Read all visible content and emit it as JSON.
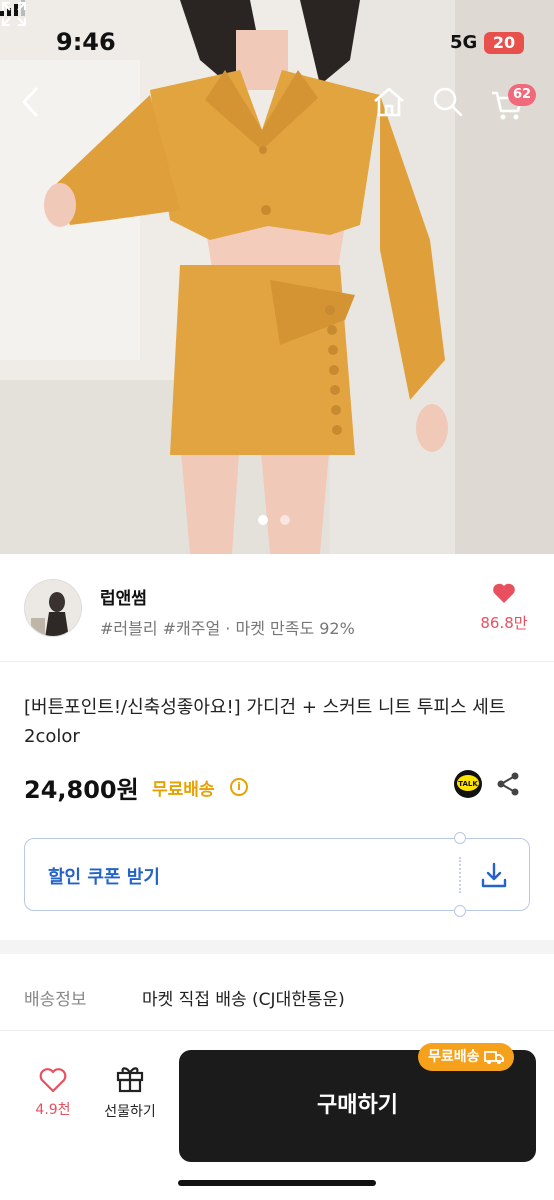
{
  "status": {
    "time": "9:46",
    "network": "5G",
    "battery": "20"
  },
  "nav": {
    "cart_count": "62"
  },
  "carousel": {
    "pages": 2,
    "active": 1
  },
  "shop": {
    "name": "럽앤썸",
    "tags": "#러블리 #캐주얼 · 마켓 만족도 92%",
    "likes": "86.8만"
  },
  "product": {
    "title": "[버튼포인트!/신축성좋아요!] 가디건 + 스커트 니트 투피스 세트 2color",
    "price": "24,800원",
    "free_shipping": "무료배송"
  },
  "coupon": {
    "label": "할인 쿠폰 받기"
  },
  "shipping": {
    "label": "배송정보",
    "value": "마켓 직접 배송 (CJ대한통운)"
  },
  "bottom": {
    "wish_count": "4.9천",
    "gift_label": "선물하기",
    "buy_label": "구매하기",
    "buy_tag": "무료배송"
  },
  "colors": {
    "accent": "#2563c9",
    "like": "#e8505f",
    "free_ship": "#e8a200",
    "buy_bg": "#1b1b1b",
    "badge": "#f06a7c"
  }
}
